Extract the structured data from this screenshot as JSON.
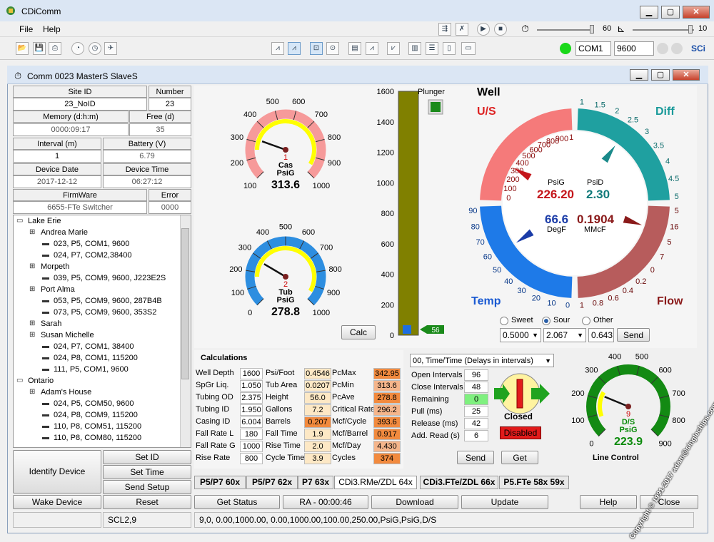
{
  "app": {
    "title": "CDiComm"
  },
  "menu": {
    "file": "File",
    "help": "Help"
  },
  "toolbar": {
    "slider1_value": "60",
    "slider2_value": "10",
    "com_port": "COM1",
    "baud": "9600",
    "brand": "SCi"
  },
  "child": {
    "title": "Comm 0023 MasterS SlaveS"
  },
  "device": {
    "site_id_label": "Site ID",
    "site_id": "23_NoID",
    "number_label": "Number",
    "number": "23",
    "memory_label": "Memory (d:h:m)",
    "memory": "0000:09:17",
    "free_label": "Free (d)",
    "free": "35",
    "interval_label": "Interval (m)",
    "interval": "1",
    "battery_label": "Battery (V)",
    "battery": "6.79",
    "date_label": "Device Date",
    "date": "2017-12-12",
    "time_label": "Device Time",
    "time": "06:27:12",
    "firmware_label": "FirmWare",
    "firmware": "6655-FTe Switcher",
    "error_label": "Error",
    "error": "0000"
  },
  "tree": [
    {
      "level": 0,
      "text": "Lake Erie"
    },
    {
      "level": 1,
      "text": "Andrea Marie"
    },
    {
      "level": 2,
      "text": "023, P5, COM1, 9600"
    },
    {
      "level": 2,
      "text": "024, P7, COM2,38400"
    },
    {
      "level": 1,
      "text": "Morpeth"
    },
    {
      "level": 2,
      "text": "039, P5, COM9, 9600, J223E2S"
    },
    {
      "level": 1,
      "text": "Port Alma"
    },
    {
      "level": 2,
      "text": "053, P5, COM9, 9600, 287B4B"
    },
    {
      "level": 2,
      "text": "073, P5, COM9, 9600, 353S2"
    },
    {
      "level": 1,
      "text": "Sarah"
    },
    {
      "level": 1,
      "text": "Susan Michelle"
    },
    {
      "level": 2,
      "text": "024, P7, COM1, 38400"
    },
    {
      "level": 2,
      "text": "024, P8, COM1, 115200"
    },
    {
      "level": 2,
      "text": "111, P5, COM1, 9600"
    },
    {
      "level": 0,
      "text": "Ontario"
    },
    {
      "level": 1,
      "text": "Adam's House"
    },
    {
      "level": 2,
      "text": "024, P5, COM50, 9600"
    },
    {
      "level": 2,
      "text": "024, P8, COM9, 115200"
    },
    {
      "level": 2,
      "text": "110, P8, COM51, 115200"
    },
    {
      "level": 2,
      "text": "110, P8, COM80, 115200"
    }
  ],
  "buttons": {
    "identify": "Identify Device",
    "set_id": "Set ID",
    "set_time": "Set Time",
    "send_setup": "Send Setup",
    "wake": "Wake Device",
    "reset": "Reset",
    "get_status": "Get Status",
    "ra": "RA - 00:00:46",
    "download": "Download",
    "update": "Update",
    "help": "Help",
    "close": "Close",
    "calc": "Calc",
    "send": "Send",
    "send2": "Send",
    "get": "Get"
  },
  "gauges": {
    "cas": {
      "id": "1",
      "name": "Cas",
      "unit": "PsiG",
      "value": "313.6",
      "ticks": [
        "100",
        "200",
        "300",
        "400",
        "500",
        "600",
        "700",
        "800",
        "900",
        "1000"
      ]
    },
    "tub": {
      "id": "2",
      "name": "Tub",
      "unit": "PsiG",
      "value": "278.8",
      "ticks": [
        "0",
        "100",
        "200",
        "300",
        "400",
        "500",
        "600",
        "700",
        "800",
        "900",
        "1000"
      ]
    },
    "line": {
      "id": "9",
      "name": "D/S",
      "unit": "PsiG",
      "value": "223.9",
      "caption": "Line Control",
      "ticks": [
        "0",
        "100",
        "200",
        "300",
        "400",
        "500",
        "600",
        "700",
        "800",
        "900"
      ]
    }
  },
  "plunger": {
    "label": "Plunger",
    "marker": "56",
    "axis": [
      "1600",
      "1400",
      "1200",
      "1000",
      "800",
      "600",
      "400",
      "200",
      "0"
    ]
  },
  "well": {
    "title": "Well",
    "us": "U/S",
    "diff": "Diff",
    "temp": "Temp",
    "flow": "Flow",
    "psig_label": "PsiG",
    "psig": "226.20",
    "psid_label": "PsiD",
    "psid": "2.30",
    "degf": "66.6",
    "degf_label": "DegF",
    "mmcf": "0.1904",
    "mmcf_label": "MMcF",
    "us_ticks": [
      "0",
      "100",
      "200",
      "300",
      "400",
      "500",
      "600",
      "700",
      "800",
      "900",
      "1"
    ],
    "diff_ticks": [
      "1",
      "1.5",
      "2",
      "2.5",
      "3",
      "3.5",
      "4",
      "4.5",
      "5"
    ],
    "temp_ticks": [
      "90",
      "80",
      "70",
      "60",
      "50",
      "40",
      "30",
      "20",
      "10",
      "0"
    ],
    "flow_ticks": [
      "1",
      "0.8",
      "0.6",
      "0.4",
      "0.2",
      "0",
      "7",
      "5",
      "16",
      "5"
    ]
  },
  "gas": {
    "sweet": "Sweet",
    "sour": "Sour",
    "other": "Other",
    "v1": "0.5000",
    "v2": "2.067",
    "v3": "0.643"
  },
  "calc": {
    "title": "Calculations",
    "rows": [
      [
        "Well Depth",
        "1600",
        "Psi/Foot",
        "0.4546",
        "PcMax",
        "342.95"
      ],
      [
        "SpGr Liq.",
        "1.050",
        "Tub Area",
        "0.0207",
        "PcMin",
        "313.6"
      ],
      [
        "Tubing OD",
        "2.375",
        "Height",
        "56.0",
        "PcAve",
        "278.8"
      ],
      [
        "Tubing ID",
        "1.950",
        "Gallons",
        "7.2",
        "Critical Rate",
        "296.2"
      ],
      [
        "Casing ID",
        "6.004",
        "Barrels",
        "0.207",
        "Mcf/Cycle",
        "393.6"
      ],
      [
        "Fall Rate L",
        "180",
        "Fall Time",
        "1.9",
        "Mcf/Barrel",
        "0.917"
      ],
      [
        "Fall Rate G",
        "1000",
        "Rise Time",
        "2.0",
        "Mcf/Day",
        "4.430"
      ],
      [
        "Rise Rate",
        "800",
        "Cycle Time",
        "3.9",
        "Cycles",
        "374"
      ]
    ]
  },
  "control": {
    "mode": "00, Time/Time (Delays in intervals)",
    "rows": [
      [
        "Open Intervals",
        "96"
      ],
      [
        "Close Intervals",
        "48"
      ],
      [
        "Remaining",
        "0"
      ],
      [
        "Pull (ms)",
        "25"
      ],
      [
        "Release (ms)",
        "42"
      ],
      [
        "Add. Read (s)",
        "6"
      ]
    ],
    "valve_state": "Closed",
    "status": "Disabled"
  },
  "tabs": [
    "P5/P7 60x",
    "P5/P7 62x",
    "P7 63x",
    "CDi3.RMe/ZDL 64x",
    "CDi3.FTe/ZDL 66x",
    "P5.FTe 58x 59x"
  ],
  "statusbar": {
    "left": "SCL2,9",
    "main": "9,0, 0.00,1000.00, 0.00,1000.00,100.00,250.00,PsiG,PsiG,D/S"
  },
  "watermark": "Copyright © 1991-2017 adam@singlechips.com"
}
